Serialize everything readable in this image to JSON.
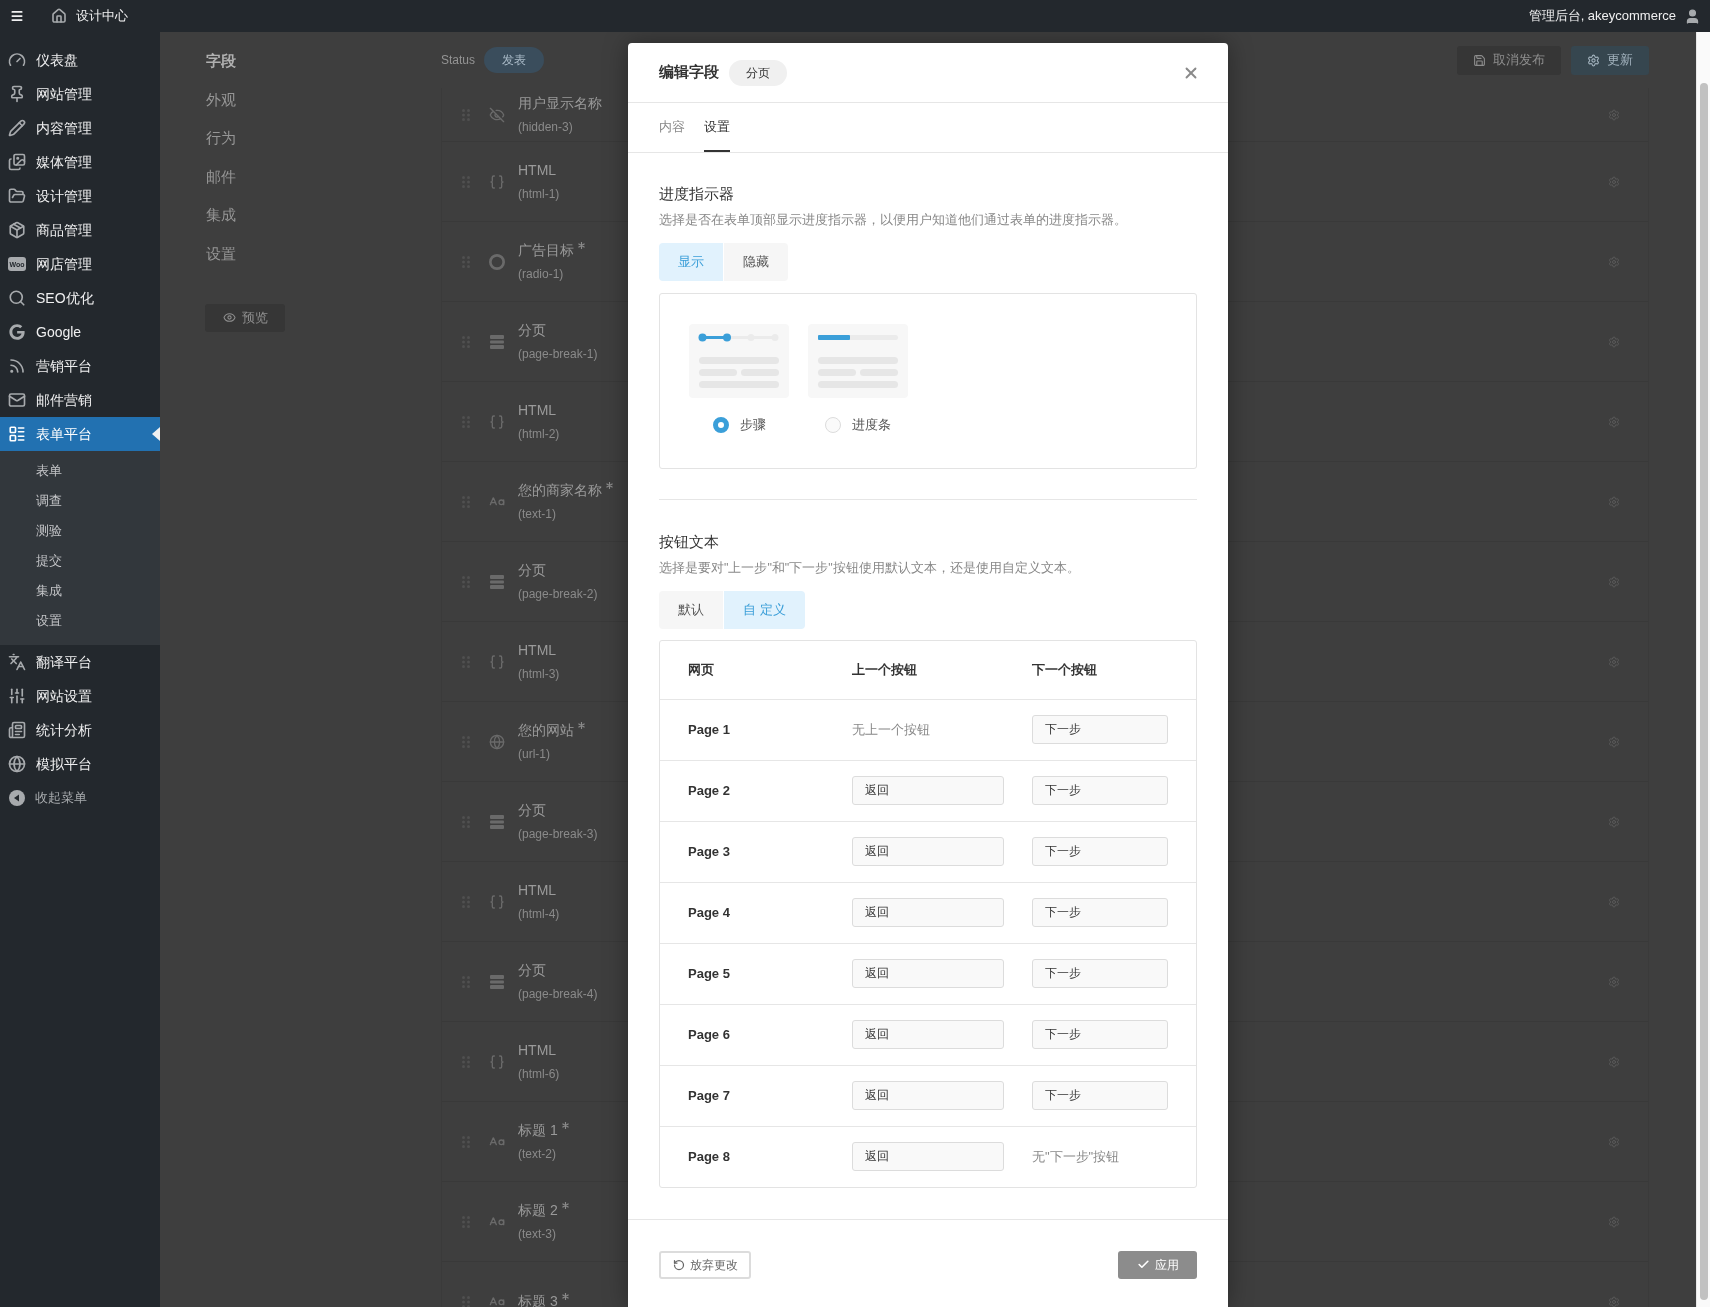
{
  "top_bar": {
    "title": "设计中心",
    "account": "管理后台, akeycommerce"
  },
  "sidebar": {
    "items": [
      {
        "label": "仪表盘",
        "selected": false
      },
      {
        "label": "网站管理",
        "selected": false
      },
      {
        "label": "内容管理",
        "selected": false
      },
      {
        "label": "媒体管理",
        "selected": false
      },
      {
        "label": "设计管理",
        "selected": false
      },
      {
        "label": "商品管理",
        "selected": false
      },
      {
        "label": "网店管理",
        "badge": "Woo",
        "selected": false
      },
      {
        "label": "SEO优化",
        "selected": false
      },
      {
        "label": "Google",
        "selected": false
      },
      {
        "label": "营销平台",
        "selected": false
      },
      {
        "label": "邮件营销",
        "selected": false
      },
      {
        "label": "表单平台",
        "selected": true,
        "children": [
          {
            "label": "表单",
            "selected": false
          },
          {
            "label": "调查",
            "selected": false
          },
          {
            "label": "测验",
            "selected": false
          },
          {
            "label": "提交",
            "selected": false
          },
          {
            "label": "集成",
            "selected": false
          },
          {
            "label": "设置",
            "selected": false
          }
        ]
      },
      {
        "label": "翻译平台",
        "selected": false
      },
      {
        "label": "网站设置",
        "selected": false
      },
      {
        "label": "统计分析",
        "selected": false
      },
      {
        "label": "模拟平台",
        "selected": false
      }
    ],
    "collapse": "收起菜单"
  },
  "builder": {
    "nav": [
      {
        "label": "字段",
        "selected": true
      },
      {
        "label": "外观",
        "selected": false
      },
      {
        "label": "行为",
        "selected": false
      },
      {
        "label": "邮件",
        "selected": false
      },
      {
        "label": "集成",
        "selected": false
      },
      {
        "label": "设置",
        "selected": false
      }
    ],
    "preview_button": "预览",
    "status": {
      "label": "Status",
      "value": "发表",
      "on": true
    },
    "actions": [
      {
        "label": "取消发布",
        "kind": "secondary"
      },
      {
        "label": "更新",
        "kind": "primary"
      }
    ],
    "fields": [
      {
        "kind": "hidden",
        "title": "用户显示名称",
        "id": "(hidden-3)",
        "required": false
      },
      {
        "kind": "html",
        "title": "HTML",
        "id": "(html-1)",
        "required": false
      },
      {
        "kind": "radio",
        "title": "广告目标",
        "id": "(radio-1)",
        "required": true
      },
      {
        "kind": "page-break",
        "title": "分页",
        "id": "(page-break-1)",
        "required": false
      },
      {
        "kind": "html",
        "title": "HTML",
        "id": "(html-2)",
        "required": false
      },
      {
        "kind": "text",
        "title": "您的商家名称",
        "id": "(text-1)",
        "required": true
      },
      {
        "kind": "page-break",
        "title": "分页",
        "id": "(page-break-2)",
        "required": false
      },
      {
        "kind": "html",
        "title": "HTML",
        "id": "(html-3)",
        "required": false
      },
      {
        "kind": "url",
        "title": "您的网站",
        "id": "(url-1)",
        "required": true
      },
      {
        "kind": "page-break",
        "title": "分页",
        "id": "(page-break-3)",
        "required": false
      },
      {
        "kind": "html",
        "title": "HTML",
        "id": "(html-4)",
        "required": false
      },
      {
        "kind": "page-break",
        "title": "分页",
        "id": "(page-break-4)",
        "required": false
      },
      {
        "kind": "html",
        "title": "HTML",
        "id": "(html-6)",
        "required": false
      },
      {
        "kind": "text",
        "title": "标题 1",
        "id": "(text-2)",
        "required": true
      },
      {
        "kind": "text",
        "title": "标题 2",
        "id": "(text-3)",
        "required": true
      },
      {
        "kind": "text",
        "title": "标题 3",
        "required": true
      }
    ]
  },
  "modal": {
    "title": "编辑字段",
    "badge": "分页",
    "tabs": [
      {
        "label": "内容",
        "selected": false
      },
      {
        "label": "设置",
        "selected": true
      }
    ],
    "progress": {
      "heading": "进度指示器",
      "description": "选择是否在表单顶部显示进度指示器，以便用户知道他们通过表单的进度指示器。",
      "toggle": [
        {
          "label": "显示",
          "selected": true
        },
        {
          "label": "隐藏",
          "selected": false
        }
      ],
      "styles": [
        {
          "kind": "steps",
          "label": "步骤",
          "selected": true
        },
        {
          "kind": "bar",
          "label": "进度条",
          "selected": false
        }
      ]
    },
    "button_text": {
      "heading": "按钮文本",
      "description": "选择是要对\"上一步\"和\"下一步\"按钮使用默认文本，还是使用自定义文本。",
      "toggle": [
        {
          "label": "默认",
          "selected": false
        },
        {
          "label": "自 定义",
          "selected": true
        }
      ],
      "table": {
        "columns": [
          "网页",
          "上一个按钮",
          "下一个按钮"
        ],
        "rows": [
          {
            "page": "Page 1",
            "previous": {
              "kind": "note",
              "text": "无上一个按钮"
            },
            "next": {
              "kind": "input",
              "value": "下一步"
            }
          },
          {
            "page": "Page 2",
            "previous": {
              "kind": "input",
              "value": "返回"
            },
            "next": {
              "kind": "input",
              "value": "下一步"
            }
          },
          {
            "page": "Page 3",
            "previous": {
              "kind": "input",
              "value": "返回"
            },
            "next": {
              "kind": "input",
              "value": "下一步"
            }
          },
          {
            "page": "Page 4",
            "previous": {
              "kind": "input",
              "value": "返回"
            },
            "next": {
              "kind": "input",
              "value": "下一步"
            }
          },
          {
            "page": "Page 5",
            "previous": {
              "kind": "input",
              "value": "返回"
            },
            "next": {
              "kind": "input",
              "value": "下一步"
            }
          },
          {
            "page": "Page 6",
            "previous": {
              "kind": "input",
              "value": "返回"
            },
            "next": {
              "kind": "input",
              "value": "下一步"
            }
          },
          {
            "page": "Page 7",
            "previous": {
              "kind": "input",
              "value": "返回"
            },
            "next": {
              "kind": "input",
              "value": "下一步"
            }
          },
          {
            "page": "Page 8",
            "previous": {
              "kind": "input",
              "value": "返回"
            },
            "next": {
              "kind": "note",
              "text": "无\"下一步\"按钮"
            }
          }
        ]
      }
    },
    "footer": {
      "discard": "放弃更改",
      "apply": "应用"
    }
  }
}
